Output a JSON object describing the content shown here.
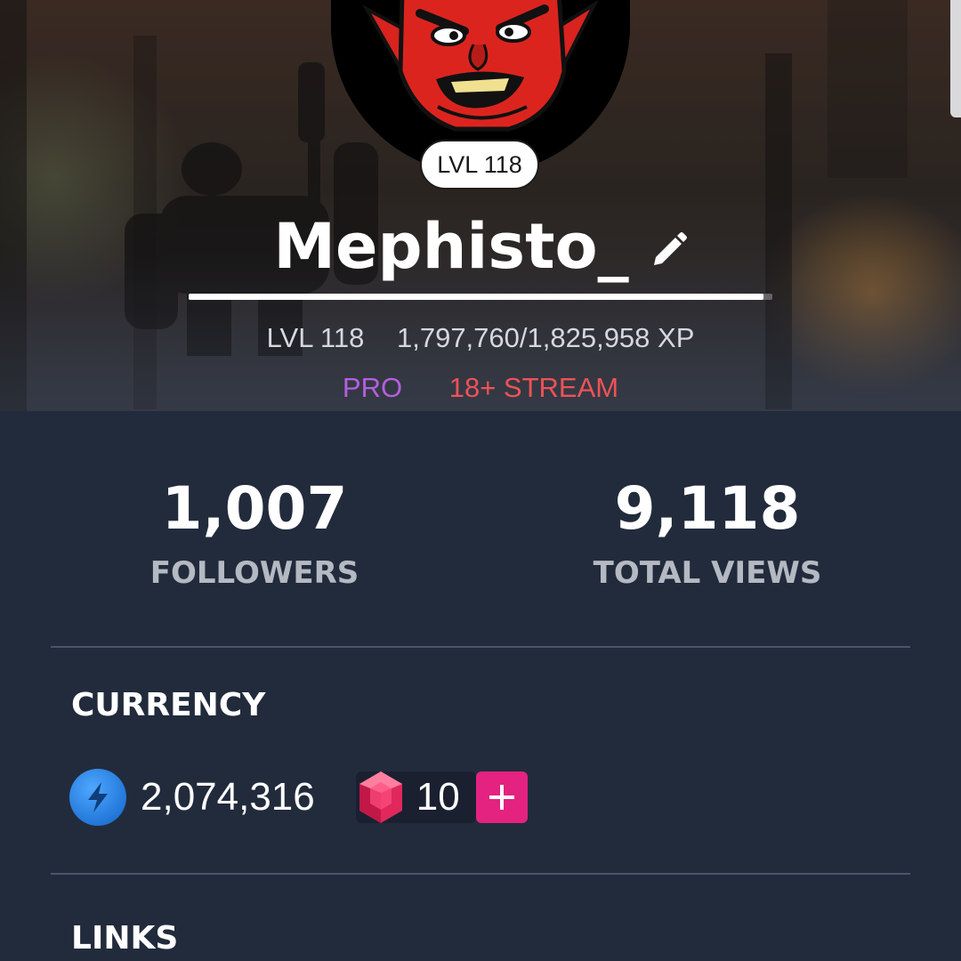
{
  "profile": {
    "badge_level": "LVL 118",
    "username": "Mephisto_",
    "level_label": "LVL 118",
    "xp_text": "1,797,760/1,825,958 XP",
    "xp_progress": 0.9846,
    "tags": {
      "pro": "PRO",
      "adult": "18+ STREAM"
    }
  },
  "stats": {
    "followers": {
      "value": "1,007",
      "label": "FOLLOWERS"
    },
    "views": {
      "value": "9,118",
      "label": "TOTAL VIEWS"
    }
  },
  "currency": {
    "title": "CURRENCY",
    "sparks": "2,074,316",
    "gems": "10"
  },
  "links": {
    "title": "LINKS"
  },
  "icons": {
    "edit": "pencil-icon",
    "sparks": "lightning-bolt-icon",
    "gems": "ruby-gem-icon",
    "add": "plus-icon"
  },
  "colors": {
    "background": "#222b3c",
    "pro": "#b45fe0",
    "adult": "#ef5257",
    "spark_blue": "#2a86ea",
    "add_pink": "#e4227f"
  }
}
